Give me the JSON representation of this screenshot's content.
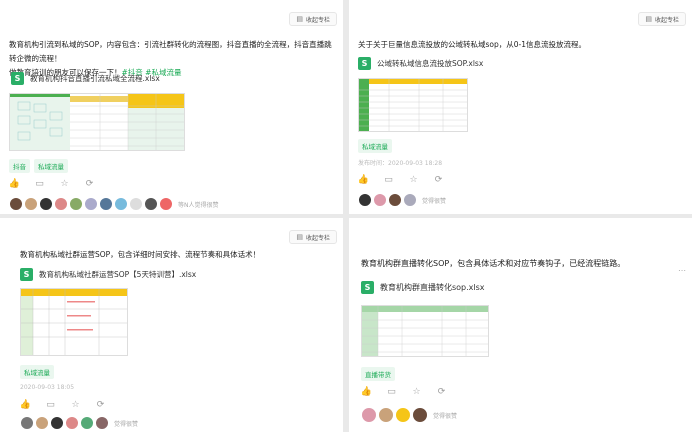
{
  "posts": [
    {
      "toggle": "收起专栏",
      "text_line1": "教育机构引流到私域的SOP，内容包含：引流社群转化的流程图，抖音直播的全流程，抖音直播跳转企微的流程！",
      "text_line2_prefix": "做教育培训的朋友可以保存一下！",
      "text_line2_tags": "#抖音 #私域流量",
      "file": "教育机构抖音直播引流私域全流程.xlsx",
      "tags": [
        "抖音",
        "私域流量"
      ],
      "date": "",
      "likes": "等N人觉得很赞"
    },
    {
      "toggle": "收起专栏",
      "text_line1": "关于关于巨量信息流投放的公域转私域sop，从0-1信息流投放流程。",
      "file": "公域转私域信息流投放SOP.xlsx",
      "tags": [
        "私域流量"
      ],
      "date": "发布时间：2020-09-03 18:28",
      "likes": "觉得很赞"
    },
    {
      "toggle": "收起专栏",
      "text_line1": "教育机构私域社群运营SOP，包含详细时间安排、流程节奏和具体话术！",
      "file": "教育机构私域社群运营SOP【5天特训营】.xlsx",
      "tags": [
        "私域流量"
      ],
      "date": "2020-09-03 18:05",
      "likes": "觉得很赞"
    },
    {
      "toggle": "",
      "text_line1": "教育机构群直播转化SOP，包含具体话术和对应节奏钩子，已经流程链路。",
      "file": "教育机构群直播转化sop.xlsx",
      "tags": [
        "直播带货"
      ],
      "date": "",
      "likes": "觉得很赞"
    }
  ],
  "icons": [
    "like-icon",
    "comment-icon",
    "star-icon",
    "share-icon",
    "collapse-icon",
    "excel-file-icon"
  ],
  "colors": {
    "accent": "#1aaa55",
    "tag_bg": "#eaf7ef"
  }
}
